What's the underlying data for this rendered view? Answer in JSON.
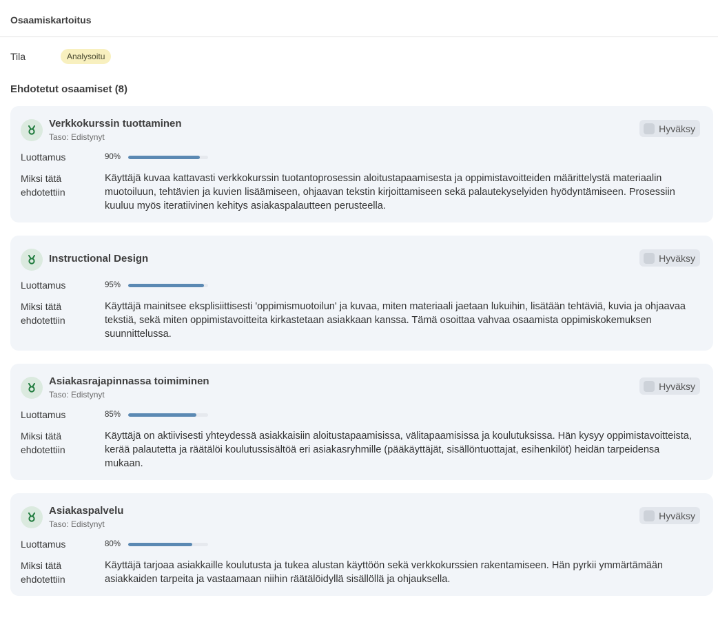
{
  "app": {
    "title": "Osaamiskartoitus"
  },
  "status": {
    "label": "Tila",
    "value": "Analysoitu"
  },
  "section": {
    "heading": "Ehdotetut osaamiset (8)"
  },
  "labels": {
    "confidence": "Luottamus",
    "reason": "Miksi tätä ehdotettiin",
    "approve": "Hyväksy"
  },
  "colors": {
    "bar": "#5b89b3",
    "badge": "#f8f0bf",
    "card": "#f2f5f9",
    "icon": "#1e7a3c"
  },
  "skills": [
    {
      "icon": "medal-icon",
      "title": "Verkkokurssin tuottaminen",
      "level": "Taso: Edistynyt",
      "confidence_text": "90%",
      "confidence": 90,
      "reason": "Käyttäjä kuvaa kattavasti verkkokurssin tuotantoprosessin aloitustapaamisesta ja oppimistavoitteiden määrittelystä materiaalin muotoiluun, tehtävien ja kuvien lisäämiseen, ohjaavan tekstin kirjoittamiseen sekä palautekyselyiden hyödyntämiseen. Prosessiin kuuluu myös iteratiivinen kehitys asiakaspalautteen perusteella."
    },
    {
      "icon": "medal-icon",
      "title": "Instructional Design",
      "level": "",
      "confidence_text": "95%",
      "confidence": 95,
      "reason": "Käyttäjä mainitsee eksplisiittisesti 'oppimismuotoilun' ja kuvaa, miten materiaali jaetaan lukuihin, lisätään tehtäviä, kuvia ja ohjaavaa tekstiä, sekä miten oppimistavoitteita kirkastetaan asiakkaan kanssa. Tämä osoittaa vahvaa osaamista oppimiskokemuksen suunnittelussa."
    },
    {
      "icon": "medal-icon",
      "title": "Asiakasrajapinnassa toimiminen",
      "level": "Taso: Edistynyt",
      "confidence_text": "85%",
      "confidence": 85,
      "reason": "Käyttäjä on aktiivisesti yhteydessä asiakkaisiin aloitustapaamisissa, välitapaamisissa ja koulutuksissa. Hän kysyy oppimistavoitteista, kerää palautetta ja räätälöi koulutussisältöä eri asiakasryhmille (pääkäyttäjät, sisällöntuottajat, esihenkilöt) heidän tarpeidensa mukaan."
    },
    {
      "icon": "medal-icon",
      "title": "Asiakaspalvelu",
      "level": "Taso: Edistynyt",
      "confidence_text": "80%",
      "confidence": 80,
      "reason": "Käyttäjä tarjoaa asiakkaille koulutusta ja tukea alustan käyttöön sekä verkkokurssien rakentamiseen. Hän pyrkii ymmärtämään asiakkaiden tarpeita ja vastaamaan niihin räätälöidyllä sisällöllä ja ohjauksella."
    }
  ]
}
